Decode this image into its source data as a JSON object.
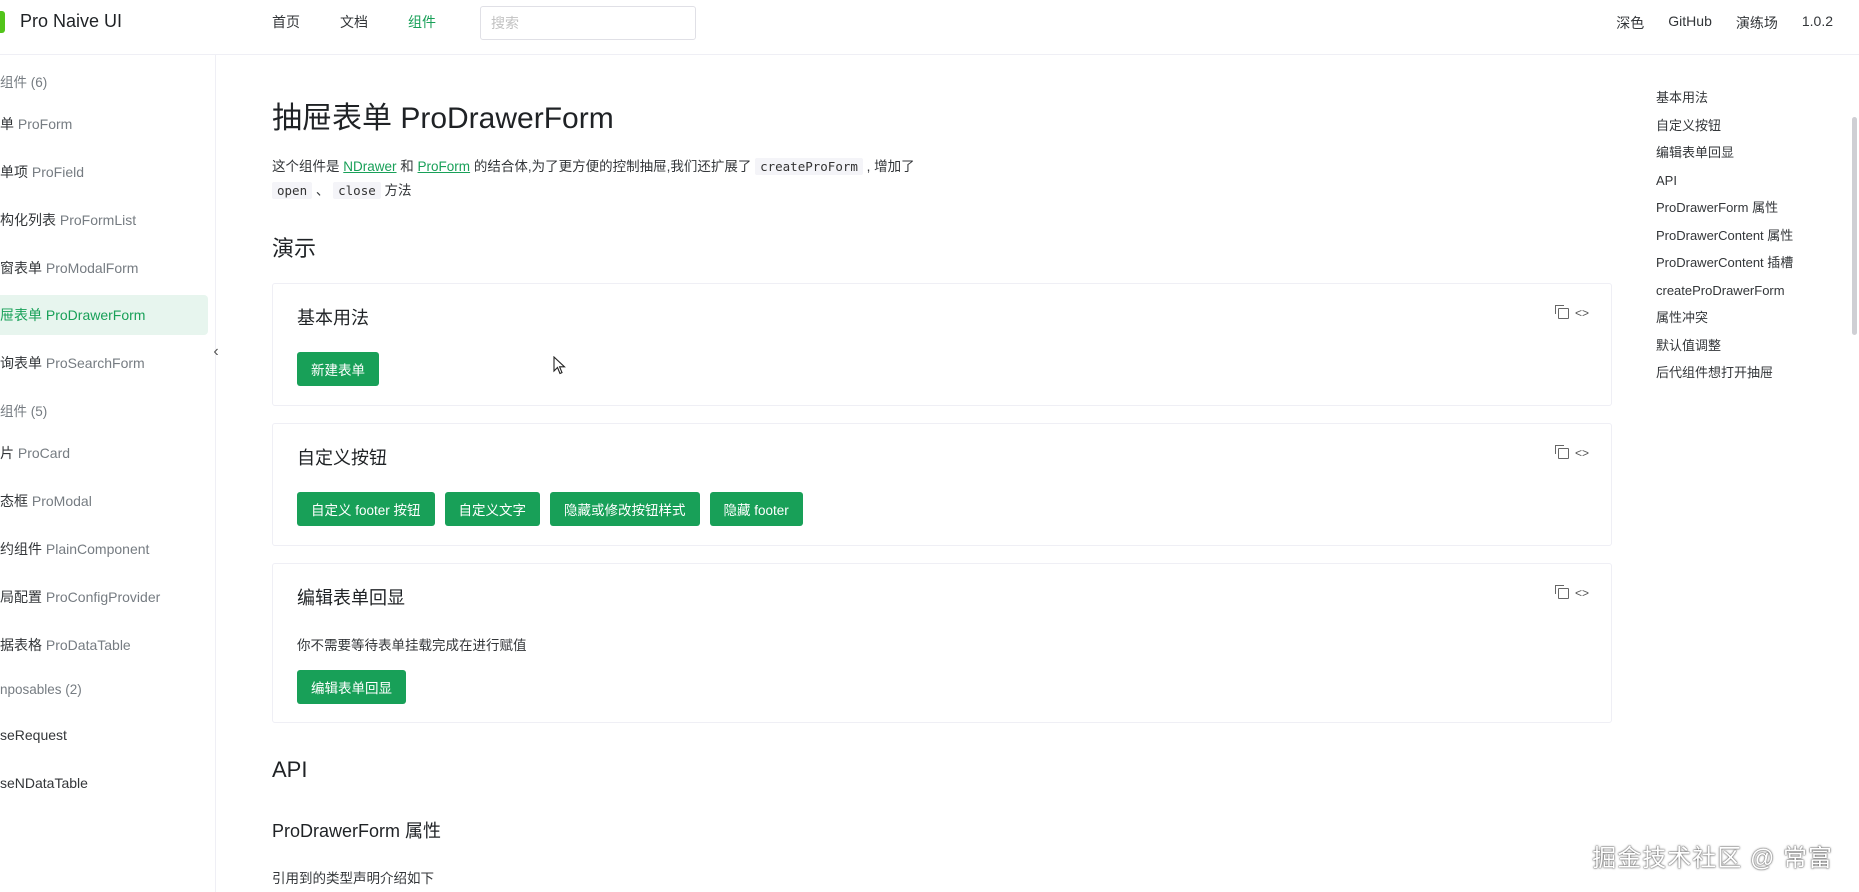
{
  "header": {
    "brand": "Pro Naive UI",
    "nav": [
      {
        "label": "首页",
        "active": false
      },
      {
        "label": "文档",
        "active": false
      },
      {
        "label": "组件",
        "active": true
      }
    ],
    "search_placeholder": "搜索",
    "right_nav": [
      "深色",
      "GitHub",
      "演练场",
      "1.0.2"
    ]
  },
  "sidebar": {
    "groups": [
      {
        "label": "组件 (6)"
      },
      {
        "label": "组件 (5)"
      },
      {
        "label": "nposables (2)"
      }
    ],
    "items": [
      {
        "zh": "单 ",
        "en": "ProForm",
        "active": false
      },
      {
        "zh": "单项 ",
        "en": "ProField",
        "active": false
      },
      {
        "zh": "构化列表 ",
        "en": "ProFormList",
        "active": false
      },
      {
        "zh": "窗表单 ",
        "en": "ProModalForm",
        "active": false
      },
      {
        "zh": "屉表单 ",
        "en": "ProDrawerForm",
        "active": true
      },
      {
        "zh": "询表单 ",
        "en": "ProSearchForm",
        "active": false
      },
      {
        "zh": "片 ",
        "en": "ProCard",
        "active": false
      },
      {
        "zh": "态框 ",
        "en": "ProModal",
        "active": false
      },
      {
        "zh": "约组件 ",
        "en": "PlainComponent",
        "active": false
      },
      {
        "zh": "局配置 ",
        "en": "ProConfigProvider",
        "active": false
      },
      {
        "zh": "据表格 ",
        "en": "ProDataTable",
        "active": false
      },
      {
        "zh": "seRequest",
        "en": "",
        "active": false
      },
      {
        "zh": "seNDataTable",
        "en": "",
        "active": false
      }
    ]
  },
  "main": {
    "title": "抽屉表单 ProDrawerForm",
    "intro": {
      "p1": "这个组件是 ",
      "link1": "NDrawer",
      "p2": " 和 ",
      "link2": "ProForm",
      "p3": " 的结合体,为了更方便的控制抽屉,我们还扩展了 ",
      "code1": "createProForm",
      "p4": " , 增加了",
      "code2": "open",
      "p5": " 、 ",
      "code3": "close",
      "p6": " 方法"
    },
    "demo_heading": "演示",
    "cards": [
      {
        "title": "基本用法",
        "buttons": [
          "新建表单"
        ],
        "desc": ""
      },
      {
        "title": "自定义按钮",
        "buttons": [
          "自定义 footer 按钮",
          "自定义文字",
          "隐藏或修改按钮样式",
          "隐藏 footer"
        ],
        "desc": ""
      },
      {
        "title": "编辑表单回显",
        "buttons": [
          "编辑表单回显"
        ],
        "desc": "你不需要等待表单挂载完成在进行赋值"
      }
    ],
    "api_heading": "API",
    "props_heading": "ProDrawerForm 属性",
    "props_desc": "引用到的类型声明介绍如下"
  },
  "toc": [
    "基本用法",
    "自定义按钮",
    "编辑表单回显",
    "API",
    "ProDrawerForm 属性",
    "ProDrawerContent 属性",
    "ProDrawerContent 插槽",
    "createProDrawerForm",
    "属性冲突",
    "默认值调整",
    "后代组件想打开抽屉"
  ],
  "watermark": "掘金技术社区 @ 常富",
  "colors": {
    "primary": "#18a058",
    "active_bg": "#e7f5ee"
  }
}
